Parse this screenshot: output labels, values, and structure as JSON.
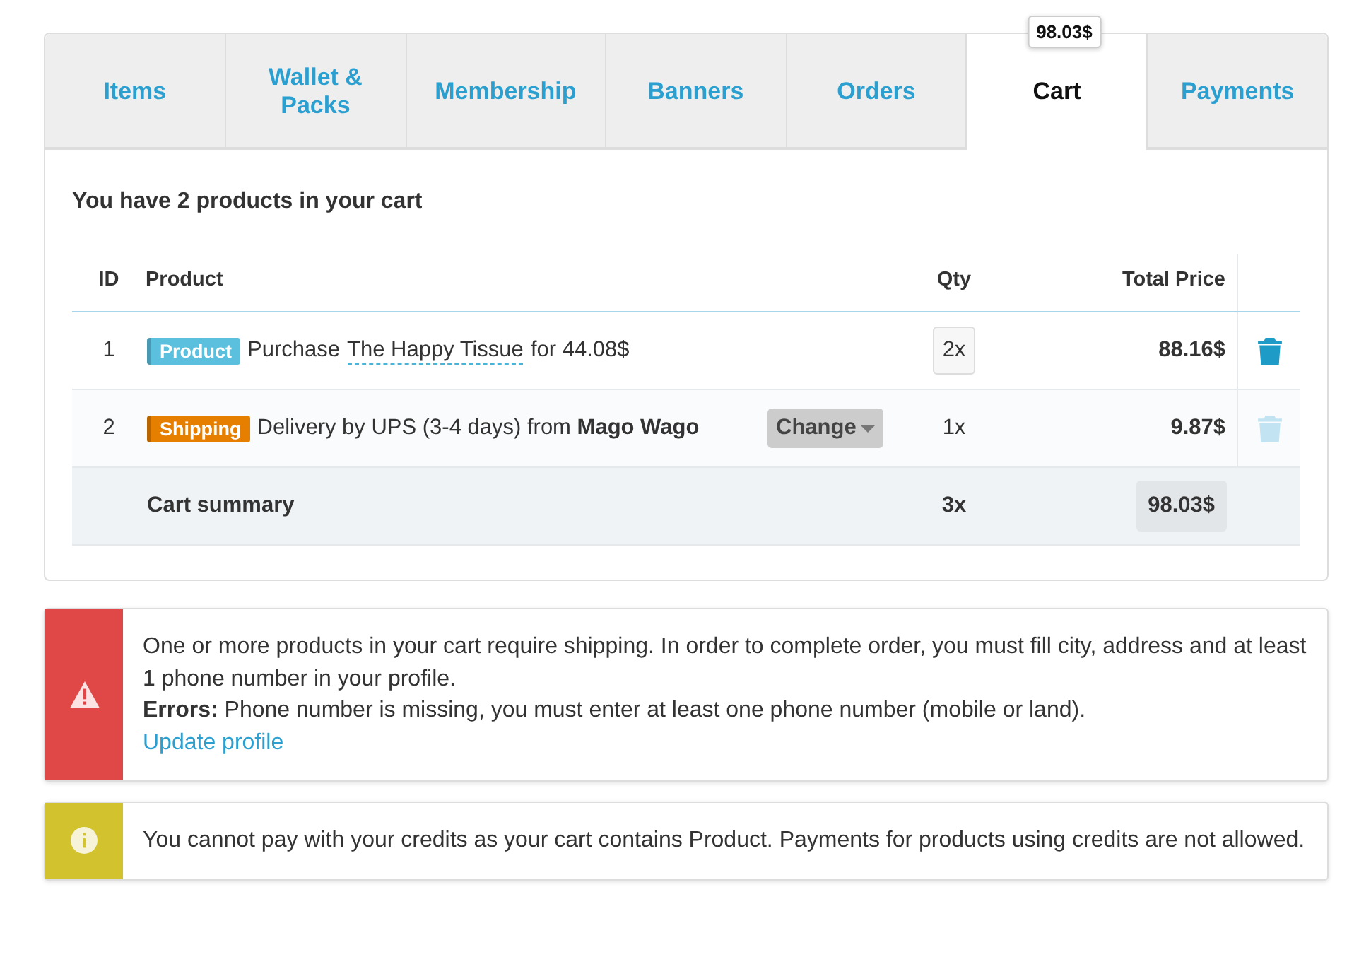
{
  "tabs": [
    {
      "label": "Items",
      "selected": false
    },
    {
      "label": "Wallet & Packs",
      "selected": false
    },
    {
      "label": "Membership",
      "selected": false
    },
    {
      "label": "Banners",
      "selected": false
    },
    {
      "label": "Orders",
      "selected": false
    },
    {
      "label": "Cart",
      "selected": true,
      "tooltip": "98.03$"
    },
    {
      "label": "Payments",
      "selected": false
    }
  ],
  "cart": {
    "heading": "You have 2 products in your cart",
    "columns": [
      "ID",
      "Product",
      "Qty",
      "Total Price"
    ],
    "rows": [
      {
        "kind": "product",
        "id": "1",
        "tag": "Product",
        "color": "#5bc0de",
        "text_before": "Purchase",
        "link": "The Happy Tissue",
        "text_after": "for 44.08$",
        "qty": "2x",
        "total": "88.16$",
        "delete_enabled": true
      },
      {
        "kind": "shipping",
        "id": "2",
        "tag": "Shipping",
        "color": "#e67e00",
        "text": "Delivery by UPS (3-4 days) from **Mago Wago**",
        "button": "Change",
        "qty": "1x",
        "total": "9.87$",
        "delete_enabled": false
      }
    ],
    "summary": {
      "label": "Cart summary",
      "qty": "3x",
      "total": "98.03$"
    }
  },
  "alerts": [
    {
      "kind": "error",
      "text": "One or more products in your cart require shipping. In order to complete order, you must fill city, address and at least 1 phone number in your profile.",
      "errors_label": "Errors:",
      "errors": "Phone number is missing, you must enter at least one phone number (mobile or land).",
      "link": "Update profile"
    },
    {
      "kind": "warning",
      "text": "You cannot pay with your credits as your cart contains Product. Payments for products using credits are not allowed."
    }
  ]
}
